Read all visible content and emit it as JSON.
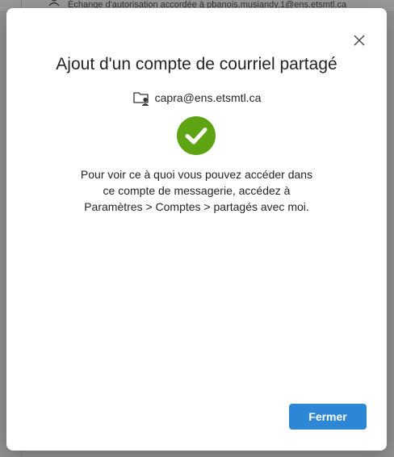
{
  "background": {
    "notice_text": "Échange d'autorisation accordée à pbanois.musiandy.1@ens.etsmtl.ca"
  },
  "dialog": {
    "title": "Ajout d'un compte de courriel partagé",
    "account_email": "capra@ens.etsmtl.ca",
    "message_lines": [
      "Pour voir ce à quoi vous pouvez accéder dans",
      "ce compte de messagerie, accédez à",
      "Paramètres > Comptes > partagés avec moi."
    ],
    "close_button_label": "Fermer",
    "icons": {
      "close": "close-icon",
      "account": "shared-folder-person-icon",
      "success": "checkmark-circle-icon"
    },
    "colors": {
      "success_green": "#5ea412",
      "primary_blue": "#2e86d6"
    }
  }
}
